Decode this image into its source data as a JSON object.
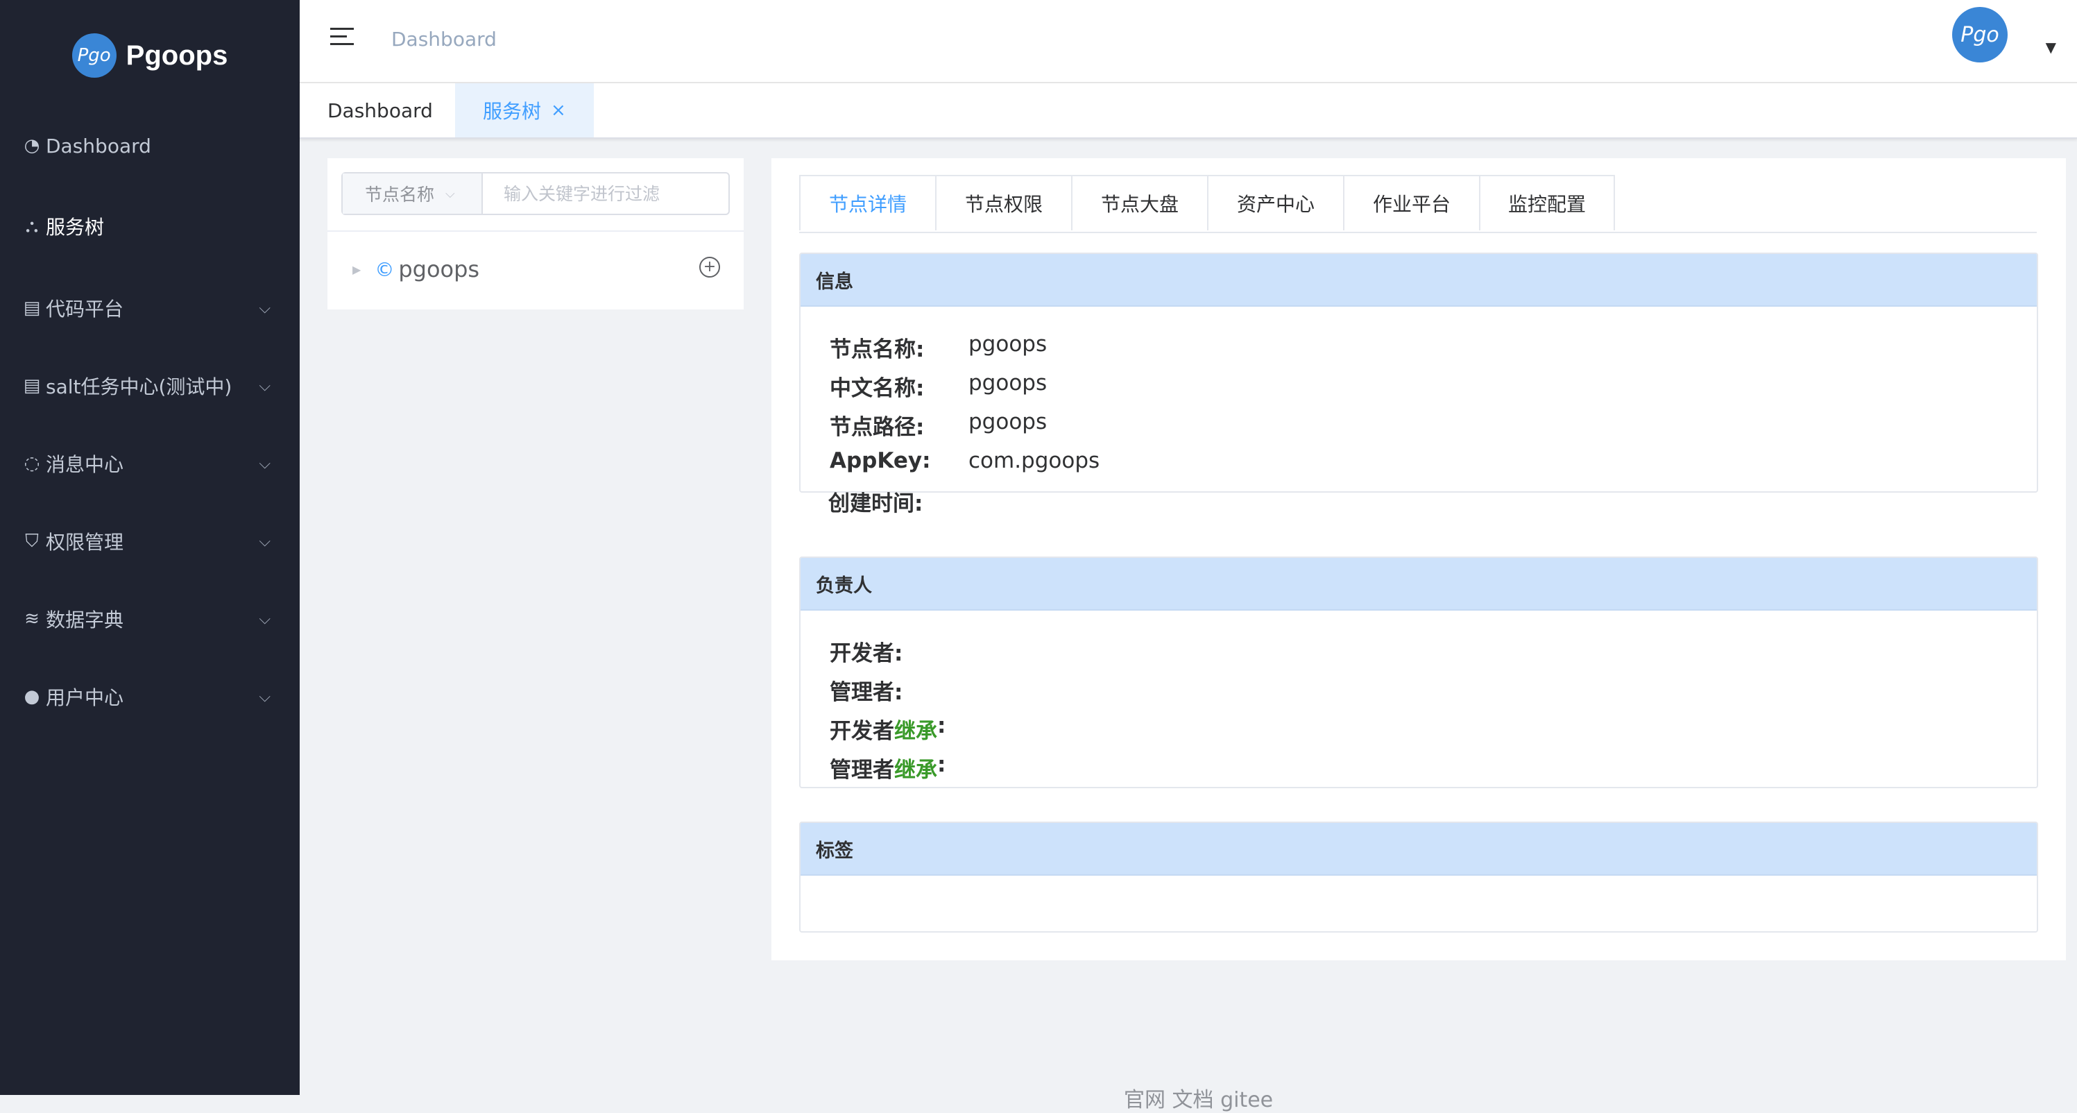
{
  "app": {
    "name": "Pgoops",
    "logo_mark": "Pgo"
  },
  "sidebar": {
    "items": [
      {
        "label": "Dashboard",
        "icon": "dashboard-icon",
        "glyph": "◔",
        "has_children": false
      },
      {
        "label": "服务树",
        "icon": "sitemap-icon",
        "glyph": "⛬",
        "has_children": false
      },
      {
        "label": "代码平台",
        "icon": "code-platform-icon",
        "glyph": "▤",
        "has_children": true
      },
      {
        "label": "salt任务中心(测试中)",
        "icon": "task-icon",
        "glyph": "▤",
        "has_children": true
      },
      {
        "label": "消息中心",
        "icon": "message-icon",
        "glyph": "◌",
        "has_children": true
      },
      {
        "label": "权限管理",
        "icon": "shield-icon",
        "glyph": "⛉",
        "has_children": true
      },
      {
        "label": "数据字典",
        "icon": "layers-icon",
        "glyph": "≋",
        "has_children": true
      },
      {
        "label": "用户中心",
        "icon": "user-icon",
        "glyph": "●",
        "has_children": true
      }
    ]
  },
  "header": {
    "breadcrumb": "Dashboard",
    "avatar_mark": "Pgo"
  },
  "tags": [
    {
      "label": "Dashboard",
      "active": false
    },
    {
      "label": "服务树",
      "active": true,
      "close": "×"
    }
  ],
  "tree": {
    "filter_select": "节点名称",
    "filter_placeholder": "输入关键字进行过滤",
    "nodes": [
      {
        "label": "pgoops",
        "prefix": "©"
      }
    ],
    "add_glyph": "+"
  },
  "detail": {
    "tabs": [
      "节点详情",
      "节点权限",
      "节点大盘",
      "资产中心",
      "作业平台",
      "监控配置"
    ],
    "active_tab": 0,
    "info": {
      "title": "信息",
      "rows": [
        {
          "key": "节点名称:",
          "value": "pgoops"
        },
        {
          "key": "中文名称:",
          "value": "pgoops"
        },
        {
          "key": "节点路径:",
          "value": "pgoops"
        },
        {
          "key": "AppKey:",
          "value": "com.pgoops"
        },
        {
          "key": "创建时间:",
          "value": ""
        }
      ]
    },
    "owners": {
      "title": "负责人",
      "rows": [
        {
          "key": "开发者:",
          "inherit": ""
        },
        {
          "key": "管理者:",
          "inherit": ""
        },
        {
          "key": "开发者 ",
          "inherit": "继承",
          "suffix": ":"
        },
        {
          "key": "管理者 ",
          "inherit": "继承",
          "suffix": ":"
        }
      ]
    },
    "labels": {
      "title": "标签"
    }
  },
  "footer": {
    "text": "官网 文档 gitee"
  },
  "colors": {
    "sidebar_bg": "#1f2330",
    "accent": "#409eff",
    "card_head": "#cde2fb",
    "inherit_green": "#3a9a2a"
  }
}
